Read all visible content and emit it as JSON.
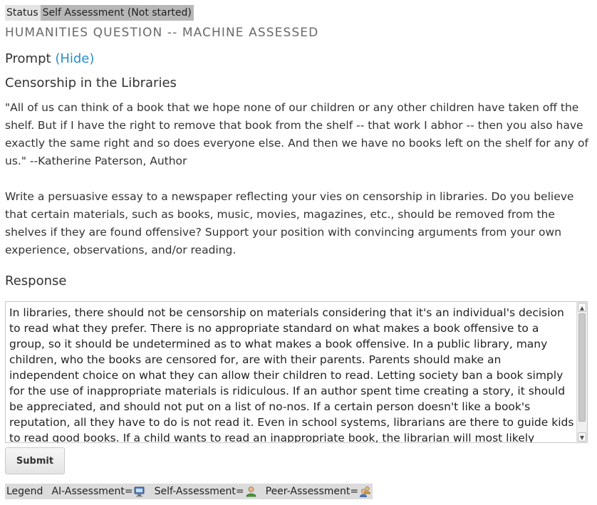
{
  "status": {
    "label": "Status",
    "value": "Self Assessment (Not started)"
  },
  "problem": {
    "header": "HUMANITIES QUESTION -- MACHINE ASSESSED",
    "prompt_label": "Prompt",
    "prompt_toggle": "(Hide)",
    "title": "Censorship in the Libraries",
    "quote": "\"All of us can think of a book that we hope none of our children or any other children have taken off the shelf. But if I have the right to remove that book from the shelf -- that work I abhor -- then you also have exactly the same right and so does everyone else. And then we have no books left on the shelf for any of us.\" --Katherine Paterson, Author",
    "instructions": "Write a persuasive essay to a newspaper reflecting your vies on censorship in libraries. Do you believe that certain materials, such as books, music, movies, magazines, etc., should be removed from the shelves if they are found offensive? Support your position with convincing arguments from your own experience, observations, and/or reading."
  },
  "response": {
    "heading": "Response",
    "text": "In libraries, there should not be censorship on materials considering that it's an individual's decision to read what they prefer. There is no appropriate standard on what makes a book offensive to a group, so it should be undetermined as to what makes a book offensive. In a public library, many children, who the books are censored for, are with their parents. Parents should make an independent choice on what they can allow their children to read. Letting society ban a book simply for the use of inappropriate materials is ridiculous. If an author spent time creating a story, it should be appreciated, and should not put on a list of no-nos. If a certain person doesn't like a book's reputation, all they have to do is not read it. Even in school systems, librarians are there to guide kids to read good books. If a child wants to read an inappropriate book, the librarian will most likely discourage him or her not to read it. In my"
  },
  "submit_label": "Submit",
  "legend": {
    "label": "Legend",
    "ai": "AI-Assessment=",
    "self": "Self-Assessment=",
    "peer": "Peer-Assessment=",
    "ai_icon": "computer-icon",
    "self_icon": "person-icon",
    "peer_icon": "people-icon"
  },
  "colors": {
    "link": "#2a8fcb",
    "status_label_bg": "#e4e4e4",
    "status_value_bg": "#b7b7b7",
    "legend_bg": "#dcdcdc"
  }
}
